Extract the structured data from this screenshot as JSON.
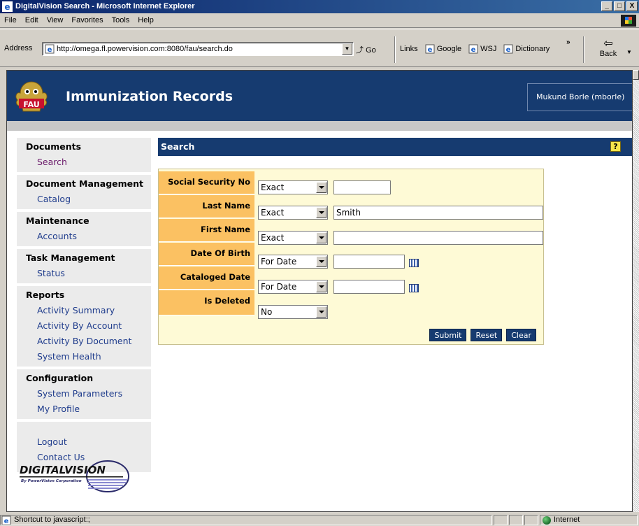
{
  "window": {
    "title": "DigitalVision Search - Microsoft Internet Explorer",
    "controls": [
      "_",
      "□",
      "X"
    ]
  },
  "menu": [
    "File",
    "Edit",
    "View",
    "Favorites",
    "Tools",
    "Help"
  ],
  "address": {
    "label": "Address",
    "url": "http://omega.fl.powervision.com:8080/fau/search.do",
    "go_label": "Go",
    "links_label": "Links",
    "links": [
      "Google",
      "WSJ",
      "Dictionary"
    ],
    "back_label": "Back"
  },
  "banner": {
    "title": "Immunization Records",
    "user": "Mukund Borle (mborle)",
    "logo_text": "FAU"
  },
  "nav": {
    "sections": [
      {
        "heading": "Documents",
        "items": [
          "Search"
        ]
      },
      {
        "heading": "Document Management",
        "items": [
          "Catalog"
        ]
      },
      {
        "heading": "Maintenance",
        "items": [
          "Accounts"
        ]
      },
      {
        "heading": "Task Management",
        "items": [
          "Status"
        ]
      },
      {
        "heading": "Reports",
        "items": [
          "Activity Summary",
          "Activity By Account",
          "Activity By Document",
          "System Health"
        ]
      },
      {
        "heading": "Configuration",
        "items": [
          "System Parameters",
          "My Profile"
        ]
      }
    ],
    "footer_items": [
      "Logout",
      "Contact Us"
    ]
  },
  "brand": {
    "name": "DIGITALVISION",
    "tagline": "By PowerVision Corporation"
  },
  "search": {
    "heading": "Search",
    "help_icon": "?",
    "fields": {
      "ssn": {
        "label": "Social Security No",
        "mode": "Exact",
        "value": ""
      },
      "last_name": {
        "label": "Last Name",
        "mode": "Exact",
        "value": "Smith"
      },
      "first_name": {
        "label": "First Name",
        "mode": "Exact",
        "value": ""
      },
      "dob": {
        "label": "Date Of Birth",
        "mode": "For Date",
        "value": ""
      },
      "cataloged": {
        "label": "Cataloged Date",
        "mode": "For Date",
        "value": ""
      },
      "deleted": {
        "label": "Is Deleted",
        "mode": "No"
      }
    },
    "buttons": {
      "submit": "Submit",
      "reset": "Reset",
      "clear": "Clear"
    }
  },
  "status": {
    "message": "Shortcut to javascript:;",
    "zone": "Internet"
  },
  "colors": {
    "banner": "#163b70",
    "label_cell": "#fbc162",
    "form_bg": "#fefad6",
    "nav_link": "#6b1b6b"
  }
}
